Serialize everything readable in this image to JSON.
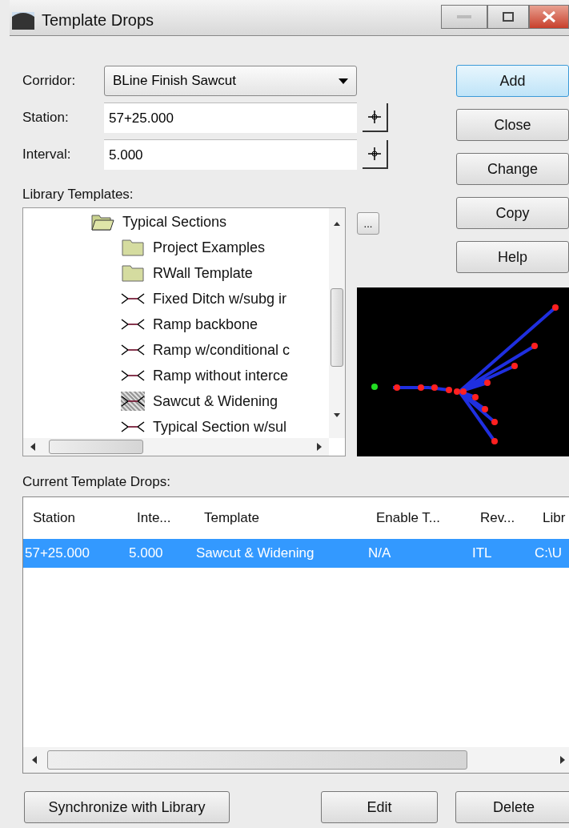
{
  "window": {
    "title": "Template Drops"
  },
  "corridor": {
    "label": "Corridor:",
    "value": "BLine Finish Sawcut"
  },
  "station": {
    "label": "Station:",
    "value": "57+25.000"
  },
  "interval": {
    "label": "Interval:",
    "value": "5.000"
  },
  "library": {
    "label": "Library Templates:",
    "browse_button": "...",
    "items": [
      {
        "kind": "folder-open",
        "label": "Typical Sections",
        "selected": false,
        "children": [
          {
            "kind": "folder",
            "label": "Project Examples",
            "selected": false
          },
          {
            "kind": "folder",
            "label": "RWall Template",
            "selected": false
          },
          {
            "kind": "template",
            "label": "Fixed Ditch w/subg ir",
            "selected": false
          },
          {
            "kind": "template",
            "label": "Ramp backbone",
            "selected": false
          },
          {
            "kind": "template",
            "label": "Ramp w/conditional c",
            "selected": false
          },
          {
            "kind": "template",
            "label": "Ramp without interce",
            "selected": false
          },
          {
            "kind": "template",
            "label": "Sawcut & Widening",
            "selected": true
          },
          {
            "kind": "template",
            "label": "Typical Section w/sul",
            "selected": false
          }
        ]
      }
    ]
  },
  "buttons": [
    "Add",
    "Close",
    "Change",
    "Copy",
    "Help"
  ],
  "drops": {
    "label": "Current Template Drops:",
    "columns": [
      "Station",
      "Inte...",
      "Template",
      "Enable T...",
      "Rev...",
      "Libr"
    ],
    "rows": [
      {
        "cells": [
          "57+25.000",
          "5.000",
          "Sawcut & Widening",
          "N/A",
          "ITL",
          "C:\\U"
        ],
        "selected": true
      }
    ]
  },
  "bottom_buttons": [
    "Synchronize with Library",
    "Edit",
    "Delete"
  ]
}
